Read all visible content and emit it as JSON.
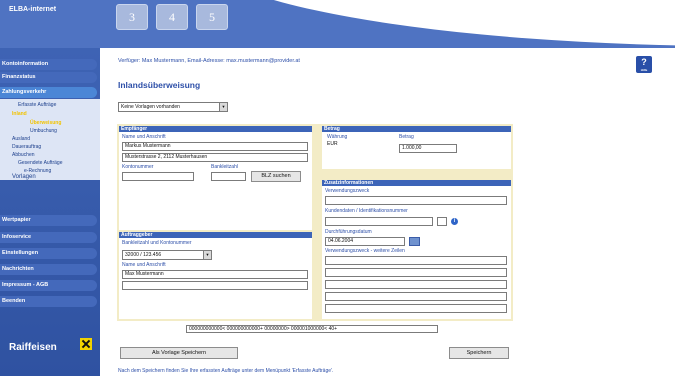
{
  "header": {
    "brand": "ELBA-internet",
    "tabs": [
      "3",
      "4",
      "5"
    ]
  },
  "sidebar": {
    "menu": [
      "Kontoinformation",
      "Finanzstatus",
      "Zahlungsverkehr",
      "Wertpapier",
      "Infoservice",
      "Einstellungen",
      "Nachrichten",
      "Impressum - AGB",
      "Beenden"
    ],
    "submenu": [
      "Erfasste Aufträge",
      "Inland",
      "Überweisung",
      "Umbuchung",
      "Ausland",
      "Dauerauftrag",
      "Abbuchen",
      "Gesendete Aufträge",
      "e-Rechnung",
      "Vorlagen"
    ],
    "logo": "Raiffeisen"
  },
  "main": {
    "user_line": "Verfüger: Max Mustermann, Email-Adresse: max.mustermann@provider.at",
    "help_label": "?",
    "help_sub": "Hilfe",
    "title": "Inlandsüberweisung",
    "template_select": "Keine Vorlagen vorhanden"
  },
  "empfaenger": {
    "header": "Empfänger",
    "name_label": "Name und Anschrift",
    "name": "Markus Mustermann",
    "address": "Musterstrasse 2, 2112 Musterhausen",
    "konto_label": "Kontonummer",
    "blz_label": "Bankleitzahl",
    "konto": "",
    "blz": "",
    "blz_button": "BLZ suchen"
  },
  "betrag": {
    "header": "Betrag",
    "currency_label": "Währung",
    "amount_label": "Betrag",
    "currency": "EUR",
    "amount": "1.000,00"
  },
  "auftraggeber": {
    "header": "Auftraggeber",
    "konto_label": "Bankleitzahl und Kontonummer",
    "konto": "32000 / 123.456",
    "name_label": "Name und Anschrift",
    "name": "Max Mustermann",
    "address": ""
  },
  "zusatz": {
    "header": "Zusatzinformationen",
    "purpose_label": "Verwendungszweck",
    "purpose": "",
    "customer_data_label": "Kundendaten / Identifikationsnummer",
    "customer_data": "",
    "date_label": "Durchführungsdatum",
    "date": "04.06.2004",
    "purpose_more_label": "Verwendungszweck - weitere Zeilen",
    "info_label": "i"
  },
  "code_line": "000000000000< 000000000000+ 00000000> 000001000000< 40+",
  "buttons": {
    "save_template": "Als Vorlage Speichern",
    "save": "Speichern"
  },
  "footnote": "Nach dem Speichern finden Sie Ihre erfassten Aufträge unter dem Menüpunkt 'Erfasste Aufträge'."
}
